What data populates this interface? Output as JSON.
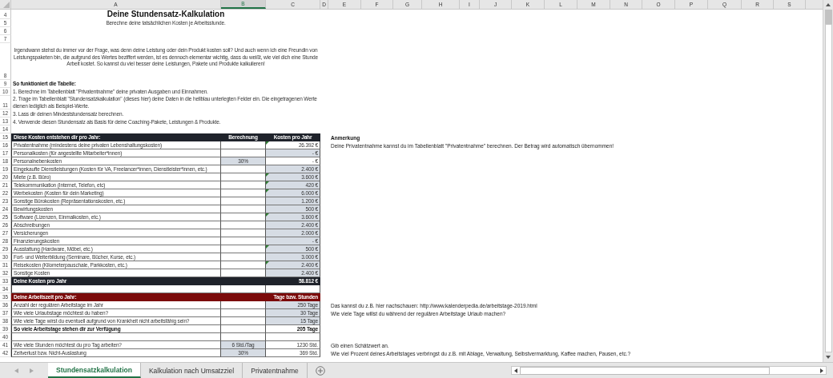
{
  "column_headers": [
    {
      "label": "A",
      "selected": false
    },
    {
      "label": "B",
      "selected": true
    },
    {
      "label": "C",
      "selected": false
    },
    {
      "label": "D",
      "selected": false
    },
    {
      "label": "E",
      "selected": false
    },
    {
      "label": "F",
      "selected": false
    },
    {
      "label": "G",
      "selected": false
    },
    {
      "label": "H",
      "selected": false
    },
    {
      "label": "I",
      "selected": false
    },
    {
      "label": "J",
      "selected": false
    },
    {
      "label": "K",
      "selected": false
    },
    {
      "label": "L",
      "selected": false
    },
    {
      "label": "M",
      "selected": false
    },
    {
      "label": "N",
      "selected": false
    },
    {
      "label": "O",
      "selected": false
    },
    {
      "label": "P",
      "selected": false
    },
    {
      "label": "Q",
      "selected": false
    },
    {
      "label": "R",
      "selected": false
    },
    {
      "label": "S",
      "selected": false
    }
  ],
  "rows": [
    {
      "num": "4",
      "kind": "title",
      "a": "Deine Stundensatz-Kalkulation"
    },
    {
      "num": "5",
      "kind": "subtitle",
      "a": "Berechne deine tatsächlichen Kosten je Arbeitsstunde."
    },
    {
      "num": "6",
      "kind": "blank"
    },
    {
      "num": "7",
      "kind": "blank"
    },
    {
      "num": "8",
      "kind": "para",
      "a": "Irgendwann stehst du immer vor der Frage, was denn deine Leistung oder dein Produkt kosten soll? Und auch wenn ich eine Freundin von Leistungspaketen bin, die aufgrund des Wertes beziffert werden, ist es dennoch elementar wichtig, dass du weißt, wie viel dich eine Stunde Arbeit kostet. So kannst du viel besser deine Leistungen, Pakete und Produkte kalkulieren!"
    },
    {
      "num": "9",
      "kind": "heading",
      "a": "So funktioniert die Tabelle:"
    },
    {
      "num": "10",
      "kind": "text",
      "a": "1. Berechne im Tabellenblatt \"Privatentnahme\" deine privaten Ausgaben und Einnahmen."
    },
    {
      "num": "11",
      "kind": "text",
      "a": "2. Trage im Tabellenblatt \"Stundensatzkalkulation\" (dieses hier) deine Daten in die hellblau unterlegten Felder ein. Die eingetragenen Werte dienen lediglich als Beispiel-Werte."
    },
    {
      "num": "12",
      "kind": "text",
      "a": "3. Lass dir deinen Mindeststundensatz berechnen."
    },
    {
      "num": "13",
      "kind": "text",
      "a": "4. Verwende diesen Stundensatz als Basis für deine Coaching-Pakete, Leistungen & Produkte."
    },
    {
      "num": "14",
      "kind": "blank"
    },
    {
      "num": "15",
      "kind": "table-head",
      "a": "Diese Kosten entstehen dir pro Jahr:",
      "b": "Berechnung",
      "c": "Kosten pro Jahr",
      "note": {
        "kind": "heading",
        "text": "Anmerkung"
      }
    },
    {
      "num": "16",
      "kind": "item",
      "a": "Privatentnahme (mindestens deine privaten Lebenshaltungskosten)",
      "c": "26.392 €",
      "b_input": false,
      "c_input": false,
      "flag": true,
      "note": {
        "kind": "text",
        "text": "Deine Privatentnahme kannst du im Tabellenblatt \"Privatentnahme\" berechnen. Der Betrag wird automatisch übernommen!"
      }
    },
    {
      "num": "17",
      "kind": "item",
      "a": "Personalkosten (für angestellte Mitarbeiter*innen)",
      "c": "-   €",
      "b_input": false,
      "c_input": true,
      "flag": false
    },
    {
      "num": "18",
      "kind": "item",
      "a": "Personalnebenkosten",
      "b": "30%",
      "c": "-   €",
      "b_input": true,
      "c_input": false,
      "flag": false
    },
    {
      "num": "19",
      "kind": "item",
      "a": "Eingekaufte Dienstleistungen (Kosten für VA, Freelancer*innen, Dienstleister*innen, etc.)",
      "c": "2.400 €",
      "b_input": false,
      "c_input": true,
      "flag": false
    },
    {
      "num": "20",
      "kind": "item",
      "a": "Miete (z.B. Büro)",
      "c": "3.600 €",
      "b_input": false,
      "c_input": true,
      "flag": true
    },
    {
      "num": "21",
      "kind": "item",
      "a": "Telekommunikation (Internet, Telefon, etc)",
      "c": "420 €",
      "b_input": false,
      "c_input": true,
      "flag": true
    },
    {
      "num": "22",
      "kind": "item",
      "a": "Werbekosten (Kosten für dein Marketing)",
      "c": "6.000 €",
      "b_input": false,
      "c_input": true,
      "flag": true
    },
    {
      "num": "23",
      "kind": "item",
      "a": "Sonstige Bürokosten (Repräsentationskosten, etc.)",
      "c": "1.200 €",
      "b_input": false,
      "c_input": true,
      "flag": false
    },
    {
      "num": "24",
      "kind": "item",
      "a": "Bewirtungskosten",
      "c": "500 €",
      "b_input": false,
      "c_input": true,
      "flag": false
    },
    {
      "num": "25",
      "kind": "item",
      "a": "Software (Lizenzen, Einmalkosten, etc.)",
      "c": "3.600 €",
      "b_input": false,
      "c_input": true,
      "flag": true
    },
    {
      "num": "26",
      "kind": "item",
      "a": "Abschreibungen",
      "c": "2.400 €",
      "b_input": false,
      "c_input": true,
      "flag": false
    },
    {
      "num": "27",
      "kind": "item",
      "a": "Versicherungen",
      "c": "2.000 €",
      "b_input": false,
      "c_input": true,
      "flag": false
    },
    {
      "num": "28",
      "kind": "item",
      "a": "Finanzierungskosten",
      "c": "-   €",
      "b_input": false,
      "c_input": true,
      "flag": false
    },
    {
      "num": "29",
      "kind": "item",
      "a": "Ausstattung (Hardware, Möbel, etc.)",
      "c": "500 €",
      "b_input": false,
      "c_input": true,
      "flag": true
    },
    {
      "num": "30",
      "kind": "item",
      "a": "Fort- und Weiterbildung (Seminare, Bücher, Kurse, etc.)",
      "c": "3.000 €",
      "b_input": false,
      "c_input": true,
      "flag": false
    },
    {
      "num": "31",
      "kind": "item",
      "a": "Reisekosten (Kilometerpauschale, Parkkosten, etc.)",
      "c": "2.400 €",
      "b_input": false,
      "c_input": true,
      "flag": true
    },
    {
      "num": "32",
      "kind": "item",
      "a": "Sonstige Kosten",
      "c": "2.400 €",
      "b_input": false,
      "c_input": true,
      "flag": false
    },
    {
      "num": "33",
      "kind": "total",
      "a": "Deine Kosten pro Jahr",
      "c": "58.812 €"
    },
    {
      "num": "34",
      "kind": "spacer"
    },
    {
      "num": "35",
      "kind": "section-head",
      "a": "Deine Arbeitszeit pro Jahr:",
      "c": "Tage bzw. Stunden"
    },
    {
      "num": "36",
      "kind": "item",
      "a": "Anzahl der regulären Arbeitstage im Jahr",
      "c": "250 Tage",
      "b_input": false,
      "c_input": true,
      "flag": false,
      "note": {
        "kind": "text",
        "text": "Das kannst du z.B. hier nachschauen: http://www.kalenderpedia.de/arbeitstage-2019.html"
      }
    },
    {
      "num": "37",
      "kind": "item",
      "a": "Wie viele Urlaubstage möchtest du haben?",
      "c": "30 Tage",
      "b_input": false,
      "c_input": true,
      "flag": false,
      "note": {
        "kind": "text",
        "text": "Wie viele Tage willst du während der regulären Arbeitstage Urlaub machen?"
      }
    },
    {
      "num": "38",
      "kind": "item",
      "a": "Wie viele Tage wirst du eventuell aufgrund von Krankheit nicht arbeitsfähig sein?",
      "c": "15 Tage",
      "b_input": false,
      "c_input": true,
      "flag": false
    },
    {
      "num": "39",
      "kind": "subtotal",
      "a": "So viele Arbeitstage stehen dir zur Verfügung",
      "c": "205 Tage"
    },
    {
      "num": "40",
      "kind": "spacer"
    },
    {
      "num": "41",
      "kind": "item",
      "a": "Wie viele Stunden möchtest du pro Tag arbeiten?",
      "b": "6 Std./Tag",
      "c": "1230 Std.",
      "b_input": true,
      "c_input": false,
      "flag": false,
      "note": {
        "kind": "text",
        "text": "Gib einen Schätzwert an."
      }
    },
    {
      "num": "42",
      "kind": "item",
      "a": "Zeitverlust bzw. Nicht-Auslastung",
      "b": "30%",
      "c": "369 Std.",
      "b_input": true,
      "c_input": false,
      "flag": false,
      "note": {
        "kind": "text",
        "text": "Wie viel Prozent deines Arbeitstages verbringst du z.B. mit Ablage, Verwaltung, Selbstvermarktung, Kaffee machen, Pausen, etc.?"
      }
    }
  ],
  "sheet_tabs": [
    {
      "label": "Stundensatzkalkulation",
      "selected": true
    },
    {
      "label": "Kalkulation nach Umsatzziel",
      "selected": false
    },
    {
      "label": "Privatentnahme",
      "selected": false
    }
  ]
}
